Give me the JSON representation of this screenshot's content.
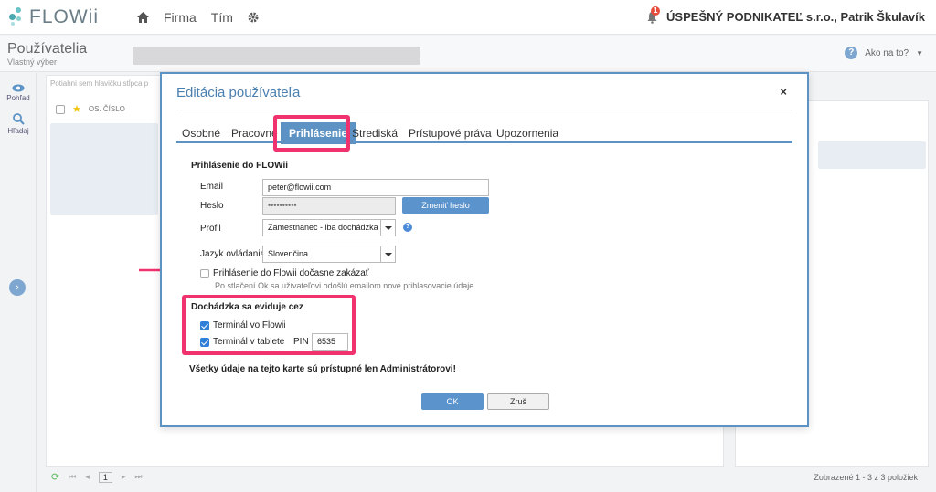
{
  "app": {
    "logo_text": "FLOWii"
  },
  "nav": {
    "firma": "Firma",
    "tim": "Tím"
  },
  "header": {
    "notification_count": "1",
    "company": "ÚSPEŠNÝ PODNIKATEĽ s.r.o., Patrik Škulavík"
  },
  "page": {
    "title": "Používatelia",
    "subtitle": "Vlastný výber"
  },
  "help": {
    "label": "Ako na to?"
  },
  "rail": {
    "view": "Pohľad",
    "search": "Hľadaj"
  },
  "table": {
    "hint": "Potiahni sem hlavičku stĺpca p",
    "col_number": "OS. ČÍSLO"
  },
  "footer": {
    "page": "1",
    "count": "Zobrazené 1 - 3 z 3 položiek"
  },
  "modal": {
    "title": "Editácia používateľa",
    "close": "×",
    "tabs": [
      "Osobné",
      "Pracovné",
      "Prihlásenie",
      "Strediská",
      "Prístupové práva",
      "Upozornenia"
    ],
    "active_tab": "Prihlásenie",
    "login_section": "Prihlásenie do FLOWii",
    "email_label": "Email",
    "email_value": "peter@flowii.com",
    "password_label": "Heslo",
    "password_value": "••••••••••",
    "change_password": "Zmeniť heslo",
    "profile_label": "Profil",
    "profile_value": "Zamestnanec - iba dochádzka",
    "language_label": "Jazyk ovládania",
    "language_value": "Slovenčina",
    "disable_login_label": "Prihlásenie do Flowii dočasne zakázať",
    "disable_login_note": "Po stlačení Ok sa užívateľovi odošlú emailom nové prihlasovacie údaje.",
    "attendance_section": "Dochádzka sa eviduje cez",
    "terminal_flowii": "Terminál vo Flowii",
    "terminal_tablet": "Terminál v tablete",
    "pin_label": "PIN",
    "pin_value": "6535",
    "admin_note": "Všetky údaje na tejto karte sú prístupné len Administrátorovi!",
    "ok": "OK",
    "cancel": "Zruš"
  },
  "colors": {
    "accent": "#5c93c4",
    "highlight": "#f0336f",
    "checkbox": "#2f7fd8"
  }
}
